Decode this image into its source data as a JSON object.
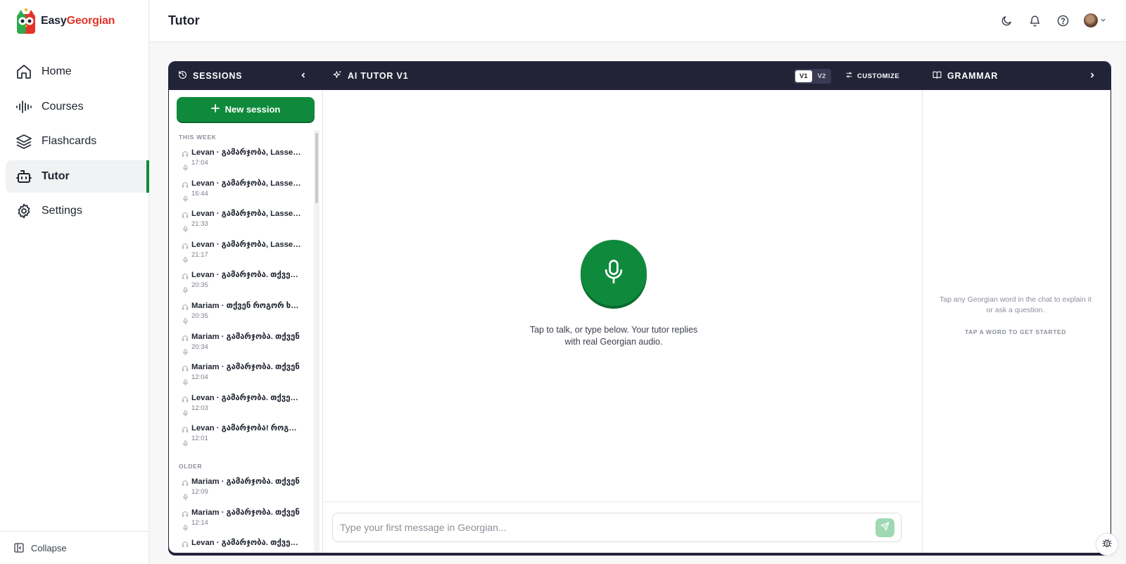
{
  "brand": {
    "name_part1": "Easy",
    "name_part2": "Georgian"
  },
  "nav": {
    "items": [
      {
        "label": "Home",
        "icon": "home-icon"
      },
      {
        "label": "Courses",
        "icon": "audio-wave-icon"
      },
      {
        "label": "Flashcards",
        "icon": "layers-icon"
      },
      {
        "label": "Tutor",
        "icon": "bot-icon",
        "active": true
      },
      {
        "label": "Settings",
        "icon": "gear-icon"
      }
    ],
    "collapse_label": "Collapse"
  },
  "header": {
    "title": "Tutor"
  },
  "sessions": {
    "title": "SESSIONS",
    "new_session_label": "New session",
    "this_week_label": "THIS WEEK",
    "older_label": "OLDER",
    "this_week": [
      {
        "name": "Levan · გამარჯობა, Lasse! როგორ",
        "time": "17:04"
      },
      {
        "name": "Levan · გამარჯობა, Lasse! როგორ",
        "time": "16:44"
      },
      {
        "name": "Levan · გამარჯობა, Lasse! როგორ",
        "time": "21:33"
      },
      {
        "name": "Levan · გამარჯობა, Lasse! როგორ",
        "time": "21:17"
      },
      {
        "name": "Levan · გამარჯობა. თქვენ როგორ",
        "time": "20:35"
      },
      {
        "name": "Mariam · თქვენ როგორ ხართ",
        "time": "20:35"
      },
      {
        "name": "Mariam · გამარჯობა. თქვენ",
        "time": "20:34"
      },
      {
        "name": "Mariam · გამარჯობა. თქვენ",
        "time": "12:04"
      },
      {
        "name": "Levan · გამარჯობა. თქვენ როგორ",
        "time": "12:03"
      },
      {
        "name": "Levan · გამარჯობა! როგორ ხარ",
        "time": "12:01"
      }
    ],
    "older": [
      {
        "name": "Mariam · გამარჯობა. თქვენ",
        "time": "12:09"
      },
      {
        "name": "Mariam · გამარჯობა. თქვენ",
        "time": "12:14"
      },
      {
        "name": "Levan · გამარჯობა. თქვენ როგორ",
        "time": ""
      }
    ]
  },
  "tutor": {
    "title": "AI TUTOR V1",
    "version_on": "V1",
    "version_off": "V2",
    "customize_label": "CUSTOMIZE",
    "hint_line1": "Tap to talk, or type below. Your tutor replies",
    "hint_line2": "with real Georgian audio.",
    "input_placeholder": "Type your first message in Georgian..."
  },
  "grammar": {
    "title": "GRAMMAR",
    "hint_line1": "Tap any Georgian word in the chat to explain it",
    "hint_line2": "or ask a question.",
    "cta": "TAP A WORD TO GET STARTED"
  },
  "colors": {
    "accent": "#0f8a3c",
    "header_dark": "#232338",
    "brand_red": "#e5332a"
  }
}
